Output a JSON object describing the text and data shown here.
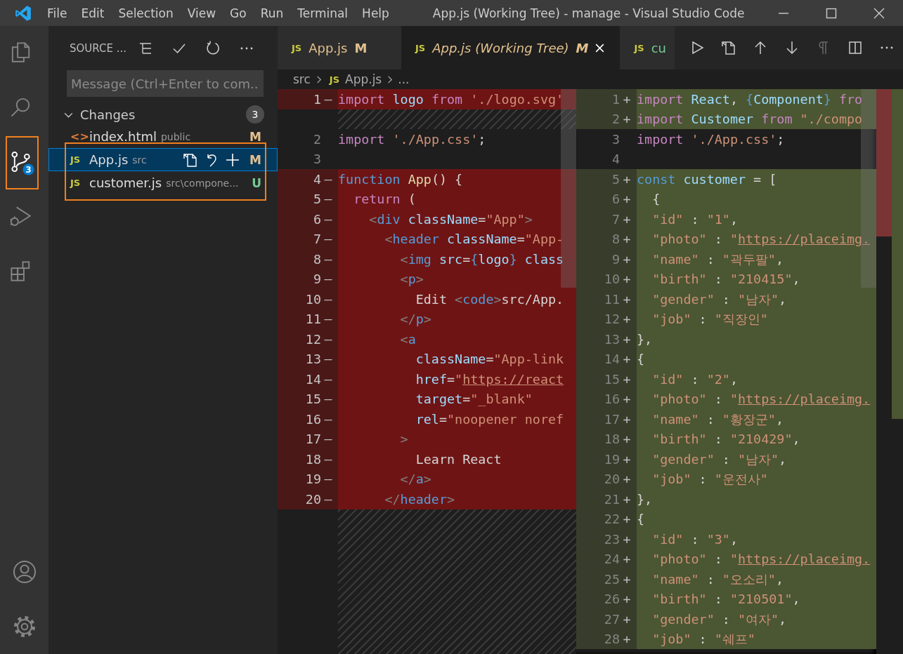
{
  "title_bar": {
    "menu": [
      "File",
      "Edit",
      "Selection",
      "View",
      "Go",
      "Run",
      "Terminal",
      "Help"
    ],
    "title": "App.js (Working Tree) - manage - Visual Studio Code"
  },
  "activity_bar": {
    "items": [
      {
        "kind": "files",
        "selected": false
      },
      {
        "kind": "search",
        "selected": false
      },
      {
        "kind": "scm",
        "selected": true,
        "badge": "3"
      },
      {
        "kind": "debug",
        "selected": false
      },
      {
        "kind": "extensions",
        "selected": false
      }
    ],
    "bottom": [
      {
        "kind": "account"
      },
      {
        "kind": "settings"
      }
    ]
  },
  "sidebar": {
    "title": "SOURCE ...",
    "message": {
      "placeholder": "Message (Ctrl+Enter to com..."
    },
    "section": {
      "label": "Changes",
      "expanded": true,
      "count": "3",
      "files": [
        {
          "kind": "html",
          "icon": "<>",
          "name": "index.html",
          "path": "public",
          "status": "M",
          "color": "#e2c08d",
          "selected": false
        },
        {
          "kind": "js",
          "icon": "JS",
          "name": "App.js",
          "path": "src",
          "status": "M",
          "color": "#e2c08d",
          "selected": true
        },
        {
          "kind": "js",
          "icon": "JS",
          "name": "customer.js",
          "path": "src\\compone...",
          "status": "U",
          "color": "#73c991",
          "selected": false
        }
      ]
    }
  },
  "tabs": [
    {
      "icon": "JS",
      "label": "App.js",
      "status": "M",
      "color": "#e2c08d",
      "italic": false,
      "selected": false
    },
    {
      "icon": "JS",
      "label": "App.js (Working Tree)",
      "status": "M",
      "color": "#e2c08d",
      "italic": true,
      "selected": true
    },
    {
      "icon": "JS",
      "label": "cu",
      "color": "#73c991",
      "italic": false,
      "selected": false
    }
  ],
  "editor_actions": [
    {
      "kind": "run",
      "disabled": false
    },
    {
      "kind": "open-file",
      "disabled": false
    },
    {
      "kind": "up",
      "disabled": false
    },
    {
      "kind": "down",
      "disabled": false
    },
    {
      "kind": "whitespace",
      "disabled": true
    },
    {
      "kind": "split",
      "disabled": false
    },
    {
      "kind": "more",
      "disabled": false
    }
  ],
  "breadcrumb": [
    {
      "label": "src"
    },
    {
      "icon": "JS",
      "label": "App.js"
    },
    {
      "label": "..."
    }
  ],
  "diff": {
    "left": {
      "lines": [
        {
          "kind": "removed",
          "number": "1",
          "marker": "—",
          "tokens": [
            {
              "kind": "kw",
              "text": "import "
            },
            {
              "kind": "var",
              "text": "logo "
            },
            {
              "kind": "kw",
              "text": "from "
            },
            {
              "kind": "str",
              "text": "'./logo.svg'"
            }
          ]
        },
        {
          "kind": "filler"
        },
        {
          "kind": "context",
          "number": "2",
          "tokens": [
            {
              "kind": "kw",
              "text": "import "
            },
            {
              "kind": "str",
              "text": "'./App.css'"
            },
            {
              "kind": "p",
              "text": ";"
            }
          ]
        },
        {
          "kind": "context",
          "number": "3"
        },
        {
          "kind": "removed",
          "number": "4",
          "marker": "—",
          "tokens": [
            {
              "kind": "decl",
              "text": "function "
            },
            {
              "kind": "fn",
              "text": "App"
            },
            {
              "kind": "p",
              "text": "() {"
            }
          ]
        },
        {
          "kind": "removed",
          "number": "5",
          "marker": "—",
          "tokens": [
            {
              "kind": "kw",
              "text": "  return"
            },
            {
              "kind": "p",
              "text": " ("
            }
          ]
        },
        {
          "kind": "removed",
          "number": "6",
          "marker": "—",
          "tokens": [
            {
              "kind": "punct",
              "text": "    <"
            },
            {
              "kind": "decl",
              "text": "div"
            },
            {
              "kind": "var",
              "text": " className"
            },
            {
              "kind": "p",
              "text": "="
            },
            {
              "kind": "str",
              "text": "\"App\""
            },
            {
              "kind": "punct",
              "text": ">"
            }
          ]
        },
        {
          "kind": "removed",
          "number": "7",
          "marker": "—",
          "tokens": [
            {
              "kind": "punct",
              "text": "      <"
            },
            {
              "kind": "decl",
              "text": "header"
            },
            {
              "kind": "var",
              "text": " className"
            },
            {
              "kind": "p",
              "text": "="
            },
            {
              "kind": "str",
              "text": "\"App-"
            }
          ]
        },
        {
          "kind": "removed",
          "number": "8",
          "marker": "—",
          "tokens": [
            {
              "kind": "punct",
              "text": "        <"
            },
            {
              "kind": "decl",
              "text": "img"
            },
            {
              "kind": "var",
              "text": " src"
            },
            {
              "kind": "p",
              "text": "="
            },
            {
              "kind": "decl",
              "text": "{"
            },
            {
              "kind": "var",
              "text": "logo"
            },
            {
              "kind": "decl",
              "text": "}"
            },
            {
              "kind": "var",
              "text": " class"
            }
          ]
        },
        {
          "kind": "removed",
          "number": "9",
          "marker": "—",
          "tokens": [
            {
              "kind": "punct",
              "text": "        <"
            },
            {
              "kind": "decl",
              "text": "p"
            },
            {
              "kind": "punct",
              "text": ">"
            }
          ]
        },
        {
          "kind": "removed",
          "number": "10",
          "marker": "—",
          "tokens": [
            {
              "kind": "p",
              "text": "          Edit "
            },
            {
              "kind": "punct",
              "text": "<"
            },
            {
              "kind": "decl",
              "text": "code"
            },
            {
              "kind": "punct",
              "text": ">"
            },
            {
              "kind": "p",
              "text": "src/App."
            }
          ]
        },
        {
          "kind": "removed",
          "number": "11",
          "marker": "—",
          "tokens": [
            {
              "kind": "punct",
              "text": "        </"
            },
            {
              "kind": "decl",
              "text": "p"
            },
            {
              "kind": "punct",
              "text": ">"
            }
          ]
        },
        {
          "kind": "removed",
          "number": "12",
          "marker": "—",
          "tokens": [
            {
              "kind": "punct",
              "text": "        <"
            },
            {
              "kind": "decl",
              "text": "a"
            }
          ]
        },
        {
          "kind": "removed",
          "number": "13",
          "marker": "—",
          "tokens": [
            {
              "kind": "var",
              "text": "          className"
            },
            {
              "kind": "p",
              "text": "="
            },
            {
              "kind": "str",
              "text": "\"App-link"
            }
          ]
        },
        {
          "kind": "removed",
          "number": "14",
          "marker": "—",
          "tokens": [
            {
              "kind": "var",
              "text": "          href"
            },
            {
              "kind": "p",
              "text": "="
            },
            {
              "kind": "str",
              "text": "\""
            },
            {
              "kind": "link",
              "text": "https://react"
            }
          ]
        },
        {
          "kind": "removed",
          "number": "15",
          "marker": "—",
          "tokens": [
            {
              "kind": "var",
              "text": "          target"
            },
            {
              "kind": "p",
              "text": "="
            },
            {
              "kind": "str",
              "text": "\"_blank\""
            }
          ]
        },
        {
          "kind": "removed",
          "number": "16",
          "marker": "—",
          "tokens": [
            {
              "kind": "var",
              "text": "          rel"
            },
            {
              "kind": "p",
              "text": "="
            },
            {
              "kind": "str",
              "text": "\"noopener noref"
            }
          ]
        },
        {
          "kind": "removed",
          "number": "17",
          "marker": "—",
          "tokens": [
            {
              "kind": "punct",
              "text": "        >"
            }
          ]
        },
        {
          "kind": "removed",
          "number": "18",
          "marker": "—",
          "tokens": [
            {
              "kind": "p",
              "text": "          Learn React"
            }
          ]
        },
        {
          "kind": "removed",
          "number": "19",
          "marker": "—",
          "tokens": [
            {
              "kind": "punct",
              "text": "        </"
            },
            {
              "kind": "decl",
              "text": "a"
            },
            {
              "kind": "punct",
              "text": ">"
            }
          ]
        },
        {
          "kind": "removed",
          "number": "20",
          "marker": "—",
          "tokens": [
            {
              "kind": "punct",
              "text": "      </"
            },
            {
              "kind": "decl",
              "text": "header"
            },
            {
              "kind": "punct",
              "text": ">"
            }
          ]
        },
        {
          "kind": "filler"
        }
      ]
    },
    "right": {
      "lines": [
        {
          "kind": "added",
          "number": "1",
          "marker": "+",
          "tokens": [
            {
              "kind": "kw",
              "text": "import "
            },
            {
              "kind": "var",
              "text": "React"
            },
            {
              "kind": "p",
              "text": ", "
            },
            {
              "kind": "decl",
              "text": "{"
            },
            {
              "kind": "var",
              "text": "Component"
            },
            {
              "kind": "decl",
              "text": "}"
            },
            {
              "kind": "kw",
              "text": " fro"
            }
          ]
        },
        {
          "kind": "added",
          "number": "2",
          "marker": "+",
          "tokens": [
            {
              "kind": "kw",
              "text": "import "
            },
            {
              "kind": "var",
              "text": "Customer "
            },
            {
              "kind": "kw",
              "text": "from "
            },
            {
              "kind": "str",
              "text": "\"./compo"
            }
          ]
        },
        {
          "kind": "context",
          "number": "3",
          "tokens": [
            {
              "kind": "kw",
              "text": "import "
            },
            {
              "kind": "str",
              "text": "'./App.css'"
            },
            {
              "kind": "p",
              "text": ";"
            }
          ]
        },
        {
          "kind": "context",
          "number": "4"
        },
        {
          "kind": "added",
          "number": "5",
          "marker": "+",
          "tokens": [
            {
              "kind": "decl",
              "text": "const "
            },
            {
              "kind": "var",
              "text": "customer"
            },
            {
              "kind": "p",
              "text": " = ["
            }
          ]
        },
        {
          "kind": "added",
          "number": "6",
          "marker": "+",
          "tokens": [
            {
              "kind": "p",
              "text": "  {"
            }
          ]
        },
        {
          "kind": "added",
          "number": "7",
          "marker": "+",
          "tokens": [
            {
              "kind": "str",
              "text": "  \"id\""
            },
            {
              "kind": "p",
              "text": " : "
            },
            {
              "kind": "str",
              "text": "\"1\""
            },
            {
              "kind": "p",
              "text": ","
            }
          ]
        },
        {
          "kind": "added",
          "number": "8",
          "marker": "+",
          "tokens": [
            {
              "kind": "str",
              "text": "  \"photo\""
            },
            {
              "kind": "p",
              "text": " : "
            },
            {
              "kind": "str",
              "text": "\""
            },
            {
              "kind": "link",
              "text": "https://placeimg."
            }
          ]
        },
        {
          "kind": "added",
          "number": "9",
          "marker": "+",
          "tokens": [
            {
              "kind": "str",
              "text": "  \"name\""
            },
            {
              "kind": "p",
              "text": " : "
            },
            {
              "kind": "str",
              "text": "\"곽두팔\""
            },
            {
              "kind": "p",
              "text": ","
            }
          ]
        },
        {
          "kind": "added",
          "number": "10",
          "marker": "+",
          "tokens": [
            {
              "kind": "str",
              "text": "  \"birth\""
            },
            {
              "kind": "p",
              "text": " : "
            },
            {
              "kind": "str",
              "text": "\"210415\""
            },
            {
              "kind": "p",
              "text": ","
            }
          ]
        },
        {
          "kind": "added",
          "number": "11",
          "marker": "+",
          "tokens": [
            {
              "kind": "str",
              "text": "  \"gender\""
            },
            {
              "kind": "p",
              "text": " : "
            },
            {
              "kind": "str",
              "text": "\"남자\""
            },
            {
              "kind": "p",
              "text": ","
            }
          ]
        },
        {
          "kind": "added",
          "number": "12",
          "marker": "+",
          "tokens": [
            {
              "kind": "str",
              "text": "  \"job\""
            },
            {
              "kind": "p",
              "text": " : "
            },
            {
              "kind": "str",
              "text": "\"직장인\""
            }
          ]
        },
        {
          "kind": "added",
          "number": "13",
          "marker": "+",
          "tokens": [
            {
              "kind": "p",
              "text": "},"
            }
          ]
        },
        {
          "kind": "added",
          "number": "14",
          "marker": "+",
          "tokens": [
            {
              "kind": "p",
              "text": "{"
            }
          ]
        },
        {
          "kind": "added",
          "number": "15",
          "marker": "+",
          "tokens": [
            {
              "kind": "str",
              "text": "  \"id\""
            },
            {
              "kind": "p",
              "text": " : "
            },
            {
              "kind": "str",
              "text": "\"2\""
            },
            {
              "kind": "p",
              "text": ","
            }
          ]
        },
        {
          "kind": "added",
          "number": "16",
          "marker": "+",
          "tokens": [
            {
              "kind": "str",
              "text": "  \"photo\""
            },
            {
              "kind": "p",
              "text": " : "
            },
            {
              "kind": "str",
              "text": "\""
            },
            {
              "kind": "link",
              "text": "https://placeimg."
            }
          ]
        },
        {
          "kind": "added",
          "number": "17",
          "marker": "+",
          "tokens": [
            {
              "kind": "str",
              "text": "  \"name\""
            },
            {
              "kind": "p",
              "text": " : "
            },
            {
              "kind": "str",
              "text": "\"황장군\""
            },
            {
              "kind": "p",
              "text": ","
            }
          ]
        },
        {
          "kind": "added",
          "number": "18",
          "marker": "+",
          "tokens": [
            {
              "kind": "str",
              "text": "  \"birth\""
            },
            {
              "kind": "p",
              "text": " : "
            },
            {
              "kind": "str",
              "text": "\"210429\""
            },
            {
              "kind": "p",
              "text": ","
            }
          ]
        },
        {
          "kind": "added",
          "number": "19",
          "marker": "+",
          "tokens": [
            {
              "kind": "str",
              "text": "  \"gender\""
            },
            {
              "kind": "p",
              "text": " : "
            },
            {
              "kind": "str",
              "text": "\"남자\""
            },
            {
              "kind": "p",
              "text": ","
            }
          ]
        },
        {
          "kind": "added",
          "number": "20",
          "marker": "+",
          "tokens": [
            {
              "kind": "str",
              "text": "  \"job\""
            },
            {
              "kind": "p",
              "text": " : "
            },
            {
              "kind": "str",
              "text": "\"운전사\""
            }
          ]
        },
        {
          "kind": "added",
          "number": "21",
          "marker": "+",
          "tokens": [
            {
              "kind": "p",
              "text": "},"
            }
          ]
        },
        {
          "kind": "added",
          "number": "22",
          "marker": "+",
          "tokens": [
            {
              "kind": "p",
              "text": "{"
            }
          ]
        },
        {
          "kind": "added",
          "number": "23",
          "marker": "+",
          "tokens": [
            {
              "kind": "str",
              "text": "  \"id\""
            },
            {
              "kind": "p",
              "text": " : "
            },
            {
              "kind": "str",
              "text": "\"3\""
            },
            {
              "kind": "p",
              "text": ","
            }
          ]
        },
        {
          "kind": "added",
          "number": "24",
          "marker": "+",
          "tokens": [
            {
              "kind": "str",
              "text": "  \"photo\""
            },
            {
              "kind": "p",
              "text": " : "
            },
            {
              "kind": "str",
              "text": "\""
            },
            {
              "kind": "link",
              "text": "https://placeimg."
            }
          ]
        },
        {
          "kind": "added",
          "number": "25",
          "marker": "+",
          "tokens": [
            {
              "kind": "str",
              "text": "  \"name\""
            },
            {
              "kind": "p",
              "text": " : "
            },
            {
              "kind": "str",
              "text": "\"오소리\""
            },
            {
              "kind": "p",
              "text": ","
            }
          ]
        },
        {
          "kind": "added",
          "number": "26",
          "marker": "+",
          "tokens": [
            {
              "kind": "str",
              "text": "  \"birth\""
            },
            {
              "kind": "p",
              "text": " : "
            },
            {
              "kind": "str",
              "text": "\"210501\""
            },
            {
              "kind": "p",
              "text": ","
            }
          ]
        },
        {
          "kind": "added",
          "number": "27",
          "marker": "+",
          "tokens": [
            {
              "kind": "str",
              "text": "  \"gender\""
            },
            {
              "kind": "p",
              "text": " : "
            },
            {
              "kind": "str",
              "text": "\"여자\""
            },
            {
              "kind": "p",
              "text": ","
            }
          ]
        },
        {
          "kind": "added",
          "number": "28",
          "marker": "+",
          "tokens": [
            {
              "kind": "str",
              "text": "  \"job\""
            },
            {
              "kind": "p",
              "text": " : "
            },
            {
              "kind": "str",
              "text": "\"쉐프\""
            }
          ]
        }
      ]
    }
  }
}
